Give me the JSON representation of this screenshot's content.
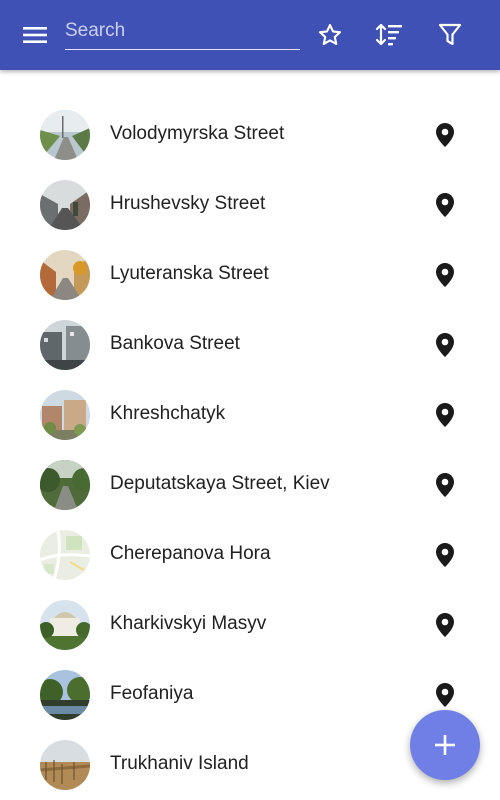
{
  "appbar": {
    "background": "#3f51b5",
    "menu_icon": "menu-icon",
    "search": {
      "placeholder": "Search",
      "value": ""
    },
    "actions": [
      {
        "icon": "star-outline-icon"
      },
      {
        "icon": "sort-icon"
      },
      {
        "icon": "filter-icon"
      }
    ]
  },
  "list": {
    "items": [
      {
        "label": "Volodymyrska Street",
        "thumbnail": "street-photo",
        "action_icon": "location-pin-icon"
      },
      {
        "label": "Hrushevsky Street",
        "thumbnail": "street-photo",
        "action_icon": "location-pin-icon"
      },
      {
        "label": "Lyuteranska Street",
        "thumbnail": "street-photo",
        "action_icon": "location-pin-icon"
      },
      {
        "label": "Bankova Street",
        "thumbnail": "street-photo",
        "action_icon": "location-pin-icon"
      },
      {
        "label": "Khreshchatyk",
        "thumbnail": "street-photo",
        "action_icon": "location-pin-icon"
      },
      {
        "label": "Deputatskaya Street, Kiev",
        "thumbnail": "street-photo",
        "action_icon": "location-pin-icon"
      },
      {
        "label": "Cherepanova Hora",
        "thumbnail": "map-image",
        "action_icon": "location-pin-icon"
      },
      {
        "label": "Kharkivskyi Masyv",
        "thumbnail": "building-photo",
        "action_icon": "location-pin-icon"
      },
      {
        "label": "Feofaniya",
        "thumbnail": "park-photo",
        "action_icon": "location-pin-icon"
      },
      {
        "label": "Trukhaniv Island",
        "thumbnail": "landscape-photo",
        "action_icon": "location-pin-icon"
      }
    ]
  },
  "fab": {
    "icon": "add-icon",
    "color": "#6f7fe6"
  }
}
